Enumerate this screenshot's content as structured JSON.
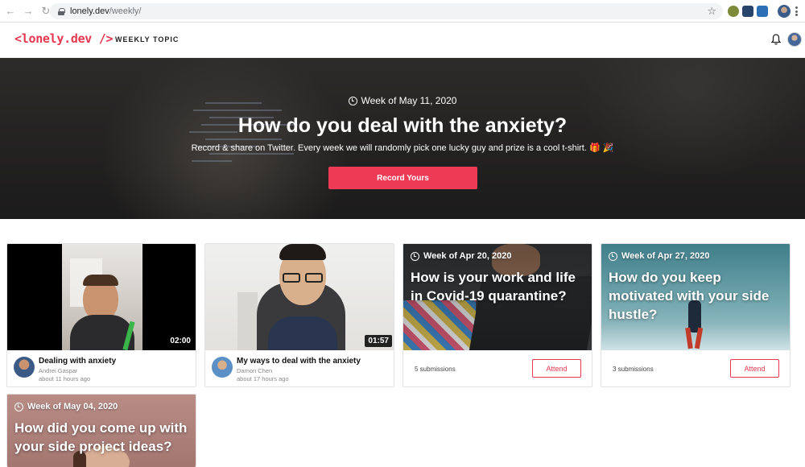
{
  "browser": {
    "url_host": "lonely.dev",
    "url_path": "/weekly/"
  },
  "header": {
    "logo": "<lonely.dev />",
    "nav_weekly": "WEEKLY TOPIC"
  },
  "hero": {
    "week": "Week of May 11, 2020",
    "title": "How do you deal with the anxiety?",
    "subtitle": "Record & share on Twitter. Every week we will randomly pick one lucky guy and prize is a cool t-shirt. 🎁 🎉",
    "button": "Record Yours"
  },
  "videos": [
    {
      "title": "Dealing with anxiety",
      "author": "Andrei Gaspar",
      "time": "about 11 hours ago",
      "duration": "02:00"
    },
    {
      "title": "My ways to deal with the anxiety",
      "author": "Damon Chen",
      "time": "about 17 hours ago",
      "duration": "01:57"
    }
  ],
  "topics": [
    {
      "week": "Week of Apr 20, 2020",
      "title": "How is your work and life in Covid-19 quarantine?",
      "submissions": "5 submissions",
      "button": "Attend"
    },
    {
      "week": "Week of Apr 27, 2020",
      "title": "How do you keep motivated with your side hustle?",
      "submissions": "3 submissions",
      "button": "Attend"
    },
    {
      "week": "Week of May 04, 2020",
      "title": "How did you come up with your side project ideas?"
    }
  ],
  "colors": {
    "accent": "#ee3b55",
    "logo": "#e63950",
    "hero_bg": "#262524"
  },
  "icons": [
    "back-icon",
    "forward-icon",
    "reload-icon",
    "lock-icon",
    "star-icon",
    "bell-icon",
    "clock-icon"
  ]
}
